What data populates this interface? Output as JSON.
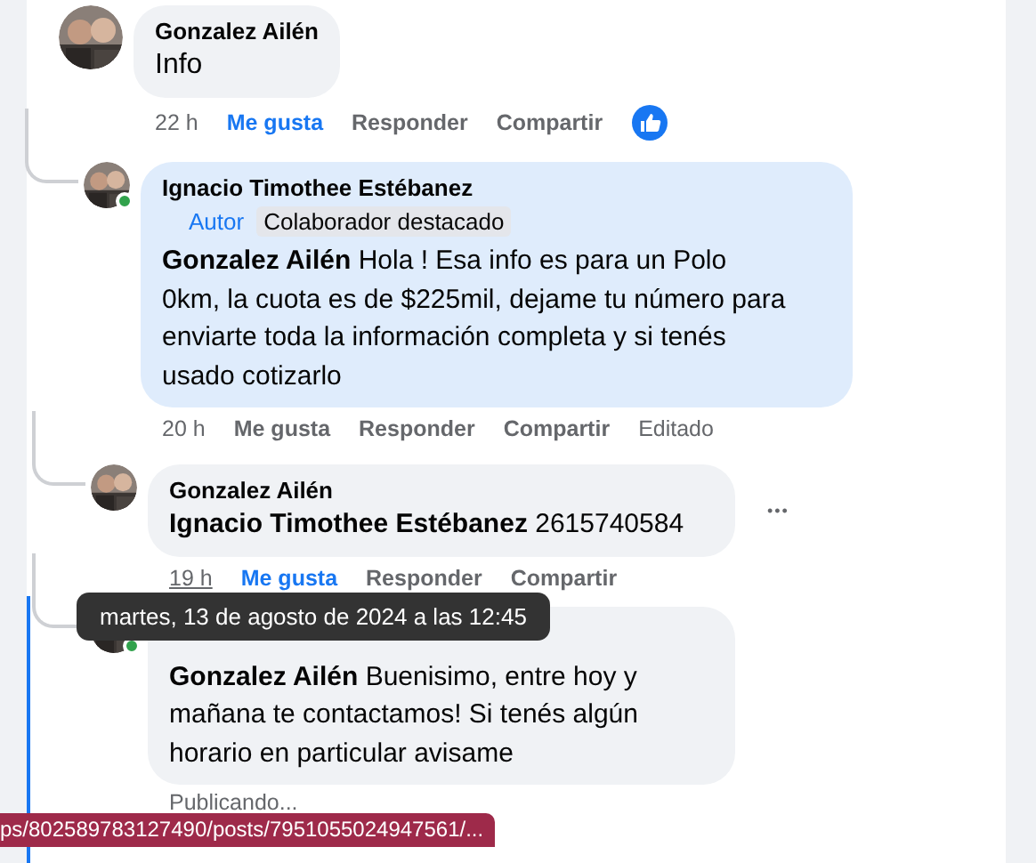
{
  "comments": [
    {
      "author": "Gonzalez Ailén",
      "text": "Info",
      "highlight": false,
      "time": "22 h",
      "time_hovered": false,
      "like": "Me gusta",
      "liked": true,
      "reply": "Responder",
      "share": "Compartir",
      "reaction": true,
      "children": [
        {
          "author": "Ignacio Timothee Estébanez",
          "badges": [
            {
              "label": "Autor",
              "kind": "role"
            },
            {
              "label": "Colaborador destacado",
              "kind": "tag"
            }
          ],
          "mention": "Gonzalez Ailén",
          "text": "Hola ! Esa info es para un Polo 0km, la cuota es de $225mil, dejame tu número para enviarte toda la información completa y si tenés usado cotizarlo",
          "online": true,
          "highlight": true,
          "time": "20 h",
          "time_hovered": false,
          "like": "Me gusta",
          "liked": false,
          "reply": "Responder",
          "share": "Compartir",
          "edited": "Editado",
          "children": [
            {
              "author": "Gonzalez Ailén",
              "mention": "Ignacio Timothee Estébanez",
              "text": "2615740584",
              "highlight": false,
              "more": "•••",
              "time": "19 h",
              "time_hovered": true,
              "like": "Me gusta",
              "liked": true,
              "reply": "Responder",
              "share": "Compartir"
            },
            {
              "mention": "Gonzalez Ailén",
              "text": "Buenisimo, entre hoy y mañana te contactamos! Si tenés algún horario en particular avisame",
              "online": true,
              "highlight": false,
              "status": "Publicando..."
            }
          ]
        }
      ]
    }
  ],
  "tooltip": "martes, 13 de agosto de 2024 a las 12:45",
  "status_url": "ps/802589783127490/posts/7951055024947561/..."
}
